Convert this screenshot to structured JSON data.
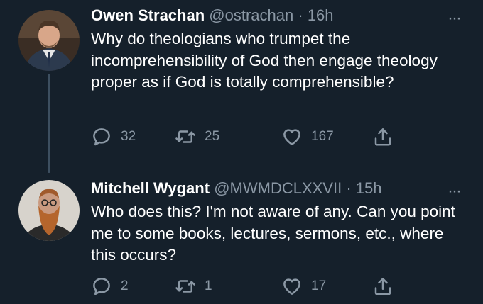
{
  "tweets": [
    {
      "author_name": "Owen Strachan",
      "handle": "@ostrachan",
      "separator": "·",
      "time": "16h",
      "more_label": "···",
      "text": "Why do theologians who trumpet the incomprehensibility of God then engage theology proper as if God is totally comprehensible?",
      "replies": "32",
      "retweets": "25",
      "likes": "167"
    },
    {
      "author_name": "Mitchell Wygant",
      "handle": "@MWMDCLXXVII",
      "separator": "·",
      "time": "15h",
      "more_label": "···",
      "text": "Who does this? I'm not aware of any. Can you point me to some books, lectures, sermons, etc., where this occurs?",
      "replies": "2",
      "retweets": "1",
      "likes": "17"
    }
  ],
  "colors": {
    "background": "#15202b",
    "text_primary": "#ffffff",
    "text_secondary": "#8b98a5",
    "thread_line": "#3d4f60"
  },
  "icons": [
    "reply-icon",
    "retweet-icon",
    "like-icon",
    "share-icon",
    "more-icon"
  ]
}
